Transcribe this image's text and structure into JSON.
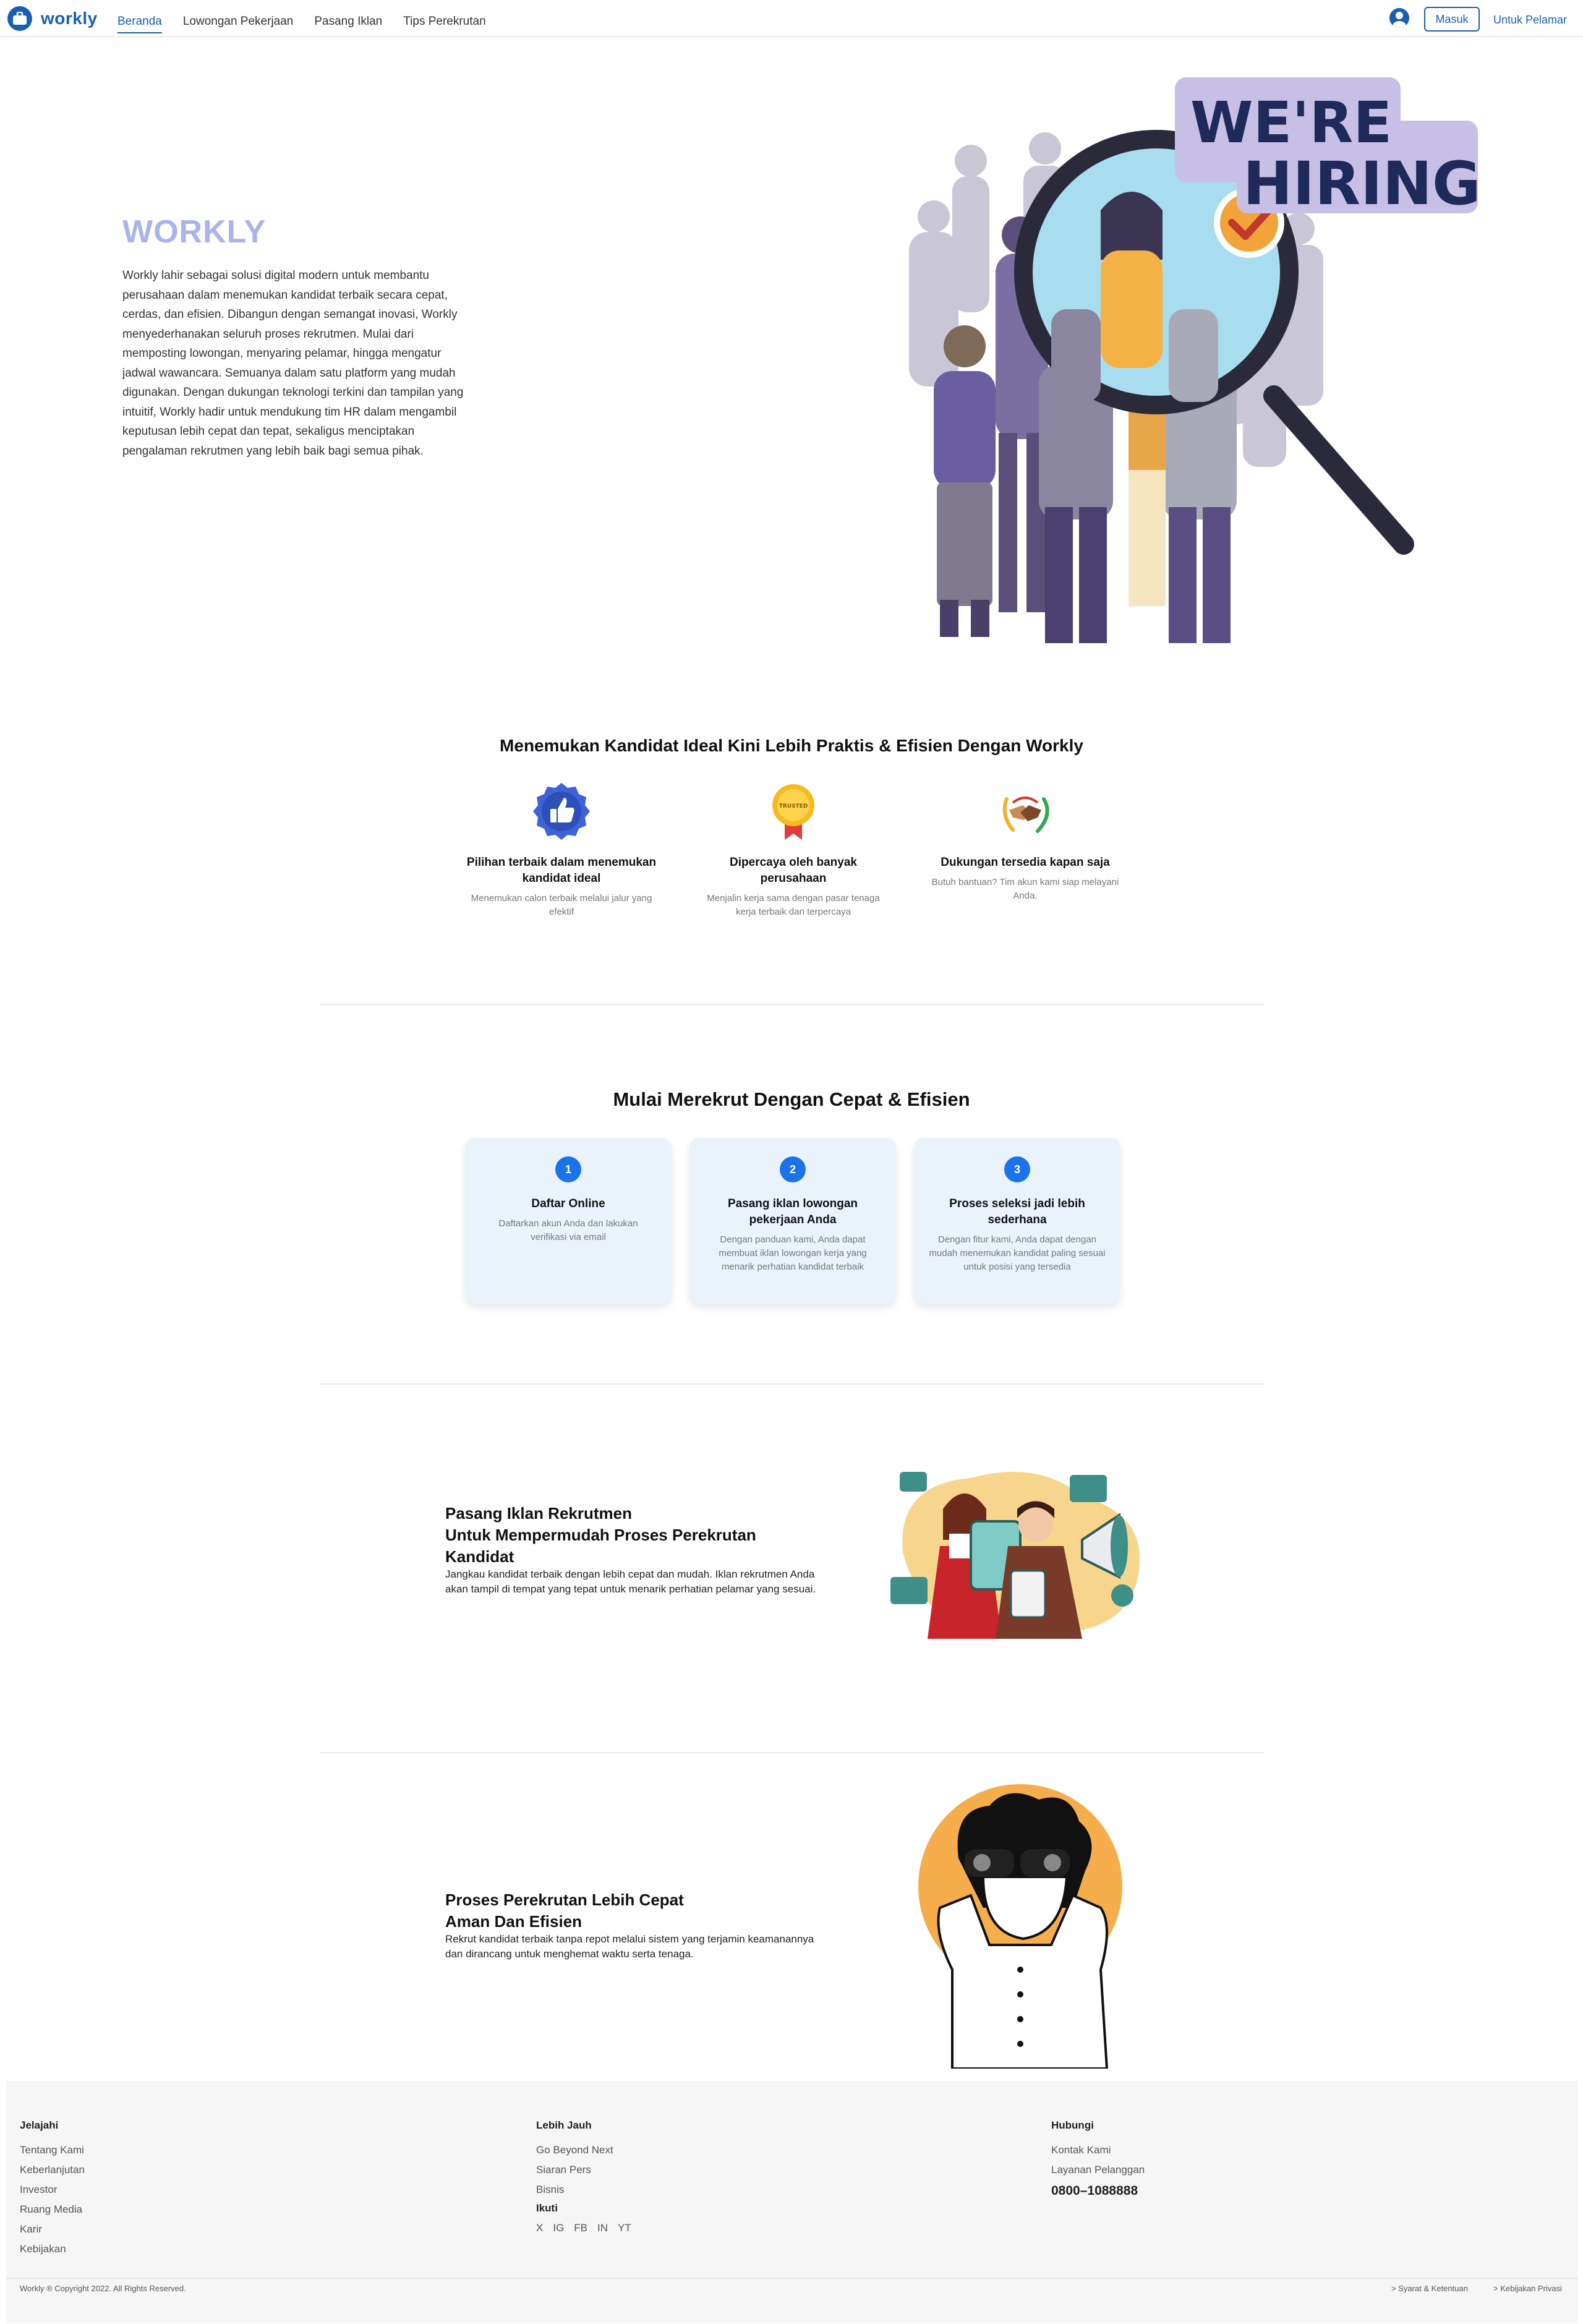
{
  "header": {
    "brand": "workly",
    "nav": [
      "Beranda",
      "Lowongan Pekerjaan",
      "Pasang Iklan",
      "Tips Perekrutan"
    ],
    "login_label": "Masuk",
    "applicant_link": "Untuk Pelamar"
  },
  "hero": {
    "title": "WORKLY",
    "body": "Workly lahir sebagai solusi digital modern untuk membantu perusahaan dalam menemukan kandidat terbaik secara cepat, cerdas, dan efisien. Dibangun dengan semangat inovasi, Workly menyederhanakan seluruh proses rekrutmen. Mulai dari memposting lowongan, menyaring pelamar, hingga mengatur jadwal wawancara. Semuanya dalam satu platform yang mudah digunakan. Dengan dukungan teknologi terkini dan tampilan yang intuitif, Workly hadir untuk mendukung tim HR dalam mengambil keputusan lebih cepat dan tepat, sekaligus menciptakan pengalaman rekrutmen yang lebih baik bagi semua pihak.",
    "illustration_text": [
      "WE'RE",
      "HIRING!"
    ]
  },
  "features": {
    "title": "Menemukan Kandidat Ideal Kini Lebih Praktis & Efisien Dengan Workly",
    "items": [
      {
        "icon": "thumbs-up-badge-icon",
        "title": "Pilihan terbaik dalam menemukan kandidat ideal",
        "desc": "Menemukan calon terbaik melalui jalur yang efektif"
      },
      {
        "icon": "trusted-medal-icon",
        "title": "Dipercaya oleh banyak perusahaan",
        "desc": "Menjalin kerja sama dengan pasar tenaga kerja terbaik dan terpercaya",
        "medal_text": "TRUSTED"
      },
      {
        "icon": "handshake-icon",
        "title": "Dukungan tersedia kapan saja",
        "desc": "Butuh bantuan? Tim akun kami siap melayani Anda."
      }
    ]
  },
  "steps": {
    "title": "Mulai Merekrut Dengan Cepat & Efisien",
    "items": [
      {
        "num": "1",
        "title": "Daftar Online",
        "desc": "Daftarkan akun Anda dan lakukan verifikasi via email"
      },
      {
        "num": "2",
        "title": "Pasang iklan lowongan pekerjaan Anda",
        "desc": "Dengan panduan kami, Anda dapat membuat iklan lowongan kerja yang menarik perhatian kandidat terbaik"
      },
      {
        "num": "3",
        "title": "Proses seleksi jadi lebih sederhana",
        "desc": "Dengan fitur kami, Anda dapat dengan mudah menemukan kandidat paling sesuai untuk posisi yang tersedia"
      }
    ]
  },
  "block_ads": {
    "title_lines": [
      "Pasang Iklan Rekrutmen",
      "Untuk Mempermudah Proses Perekrutan",
      "Kandidat"
    ],
    "desc": "Jangkau kandidat terbaik dengan lebih cepat dan mudah. Iklan rekrutmen Anda akan tampil di tempat yang tepat untuk menarik perhatian pelamar yang sesuai."
  },
  "block_process": {
    "title_lines": [
      "Proses Perekrutan Lebih Cepat",
      "Aman Dan Efisien"
    ],
    "desc": "Rekrut kandidat terbaik tanpa repot melalui sistem yang terjamin keamanannya dan dirancang untuk menghemat waktu serta tenaga."
  },
  "footer": {
    "col1": {
      "heading": "Jelajahi",
      "links": [
        "Tentang Kami",
        "Keberlanjutan",
        "Investor",
        "Ruang Media",
        "Karir",
        "Kebijakan"
      ]
    },
    "col2": {
      "heading": "Lebih Jauh",
      "links": [
        "Go Beyond Next",
        "Siaran Pers",
        "Bisnis"
      ],
      "follow_heading": "Ikuti",
      "social": [
        "X",
        "IG",
        "FB",
        "IN",
        "YT"
      ]
    },
    "col3": {
      "heading": "Hubungi",
      "links": [
        "Kontak Kami",
        "Layanan Pelanggan"
      ],
      "phone": "0800–1088888"
    },
    "copyright": "Workly ® Copyright 2022. All Rights Reserved.",
    "legal": [
      "> Syarat & Ketentuan",
      "> Kebijakan Privasi"
    ]
  },
  "colors": {
    "primary": "#1a5fb4",
    "hero_title": "#a9b4ea",
    "card_bg": "#eaf3fb",
    "step_badge": "#1a73e8",
    "footer_bg": "#f6f6f6"
  }
}
